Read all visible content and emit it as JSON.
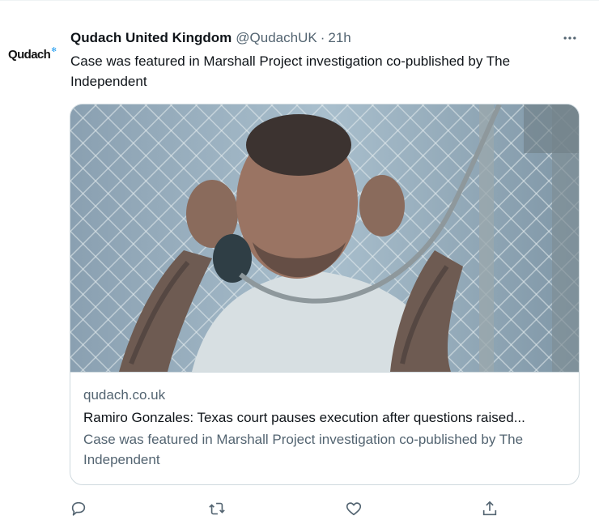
{
  "account": {
    "avatar_text": "Qudach",
    "display_name": "Qudach United Kingdom",
    "handle": "@QudachUK",
    "separator": "·",
    "time": "21h"
  },
  "tweet": {
    "text": "Case was featured in Marshall Project investigation co-published by The Independent"
  },
  "card": {
    "domain": "qudach.co.uk",
    "title": "Ramiro Gonzales: Texas court pauses execution after questions raised...",
    "description": "Case was featured in Marshall Project investigation co-published by The Independent",
    "image_alt": "Man with tattooed arms speaking on a prison visitation phone"
  },
  "actions": {
    "reply_icon": "reply-icon",
    "retweet_icon": "retweet-icon",
    "like_icon": "heart-icon",
    "share_icon": "share-icon"
  },
  "colors": {
    "text": "#0f1419",
    "secondary": "#536471",
    "border": "#cfd9de",
    "brand_accent": "#1d9bf0"
  }
}
